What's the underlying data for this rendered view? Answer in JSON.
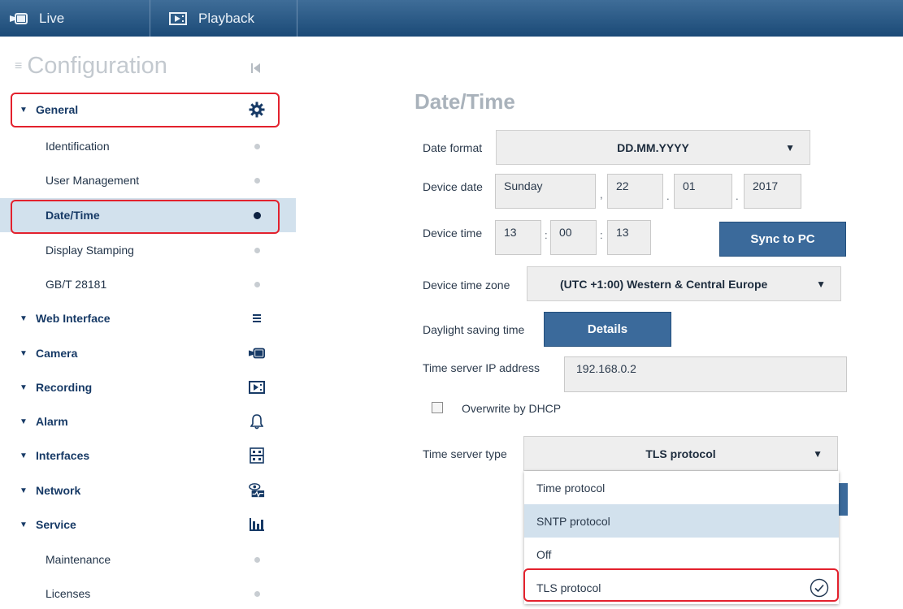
{
  "topbar": {
    "tabs": [
      {
        "label": "Live",
        "icon": "camera-icon"
      },
      {
        "label": "Playback",
        "icon": "playback-icon"
      }
    ]
  },
  "sidebar": {
    "title": "Configuration",
    "sections": [
      {
        "label": "General",
        "icon": "gear-icon",
        "expanded": true,
        "items": [
          {
            "label": "Identification",
            "status": "inactive"
          },
          {
            "label": "User Management",
            "status": "inactive"
          },
          {
            "label": "Date/Time",
            "status": "active"
          },
          {
            "label": "Display Stamping",
            "status": "inactive"
          },
          {
            "label": "GB/T 28181",
            "status": "inactive"
          }
        ]
      },
      {
        "label": "Web Interface",
        "icon": "menu-icon"
      },
      {
        "label": "Camera",
        "icon": "camera-icon"
      },
      {
        "label": "Recording",
        "icon": "recording-icon"
      },
      {
        "label": "Alarm",
        "icon": "bell-icon"
      },
      {
        "label": "Interfaces",
        "icon": "interfaces-icon"
      },
      {
        "label": "Network",
        "icon": "network-icon"
      },
      {
        "label": "Service",
        "icon": "service-chart-icon",
        "expanded": true,
        "items": [
          {
            "label": "Maintenance",
            "status": "inactive"
          },
          {
            "label": "Licenses",
            "status": "inactive"
          }
        ]
      }
    ]
  },
  "main": {
    "title": "Date/Time",
    "date_format": {
      "label": "Date format",
      "value": "DD.MM.YYYY"
    },
    "device_date": {
      "label": "Device date",
      "weekday": "Sunday",
      "day": "22",
      "month": "01",
      "year": "2017",
      "sep1": ",",
      "sep2": ".",
      "sep3": "."
    },
    "device_time": {
      "label": "Device time",
      "hours": "13",
      "minutes": "00",
      "seconds": "13",
      "sep": ":",
      "sync_button": "Sync to PC"
    },
    "time_zone": {
      "label": "Device time zone",
      "value": "(UTC +1:00) Western & Central Europe"
    },
    "dst": {
      "label": "Daylight saving time",
      "button": "Details"
    },
    "time_server_ip": {
      "label": "Time server IP address",
      "value": "192.168.0.2"
    },
    "overwrite_dhcp": {
      "label": "Overwrite by DHCP",
      "checked": false
    },
    "time_server_type": {
      "label": "Time server type",
      "value": "TLS protocol",
      "options": [
        "Time protocol",
        "SNTP protocol",
        "Off",
        "TLS protocol"
      ],
      "selected_index": 3,
      "hover_index": 1
    }
  },
  "colors": {
    "accent": "#3b6a9b",
    "highlight": "#e3212d",
    "selected_bg": "#d2e1ed",
    "topbar": "#1b4a77"
  }
}
